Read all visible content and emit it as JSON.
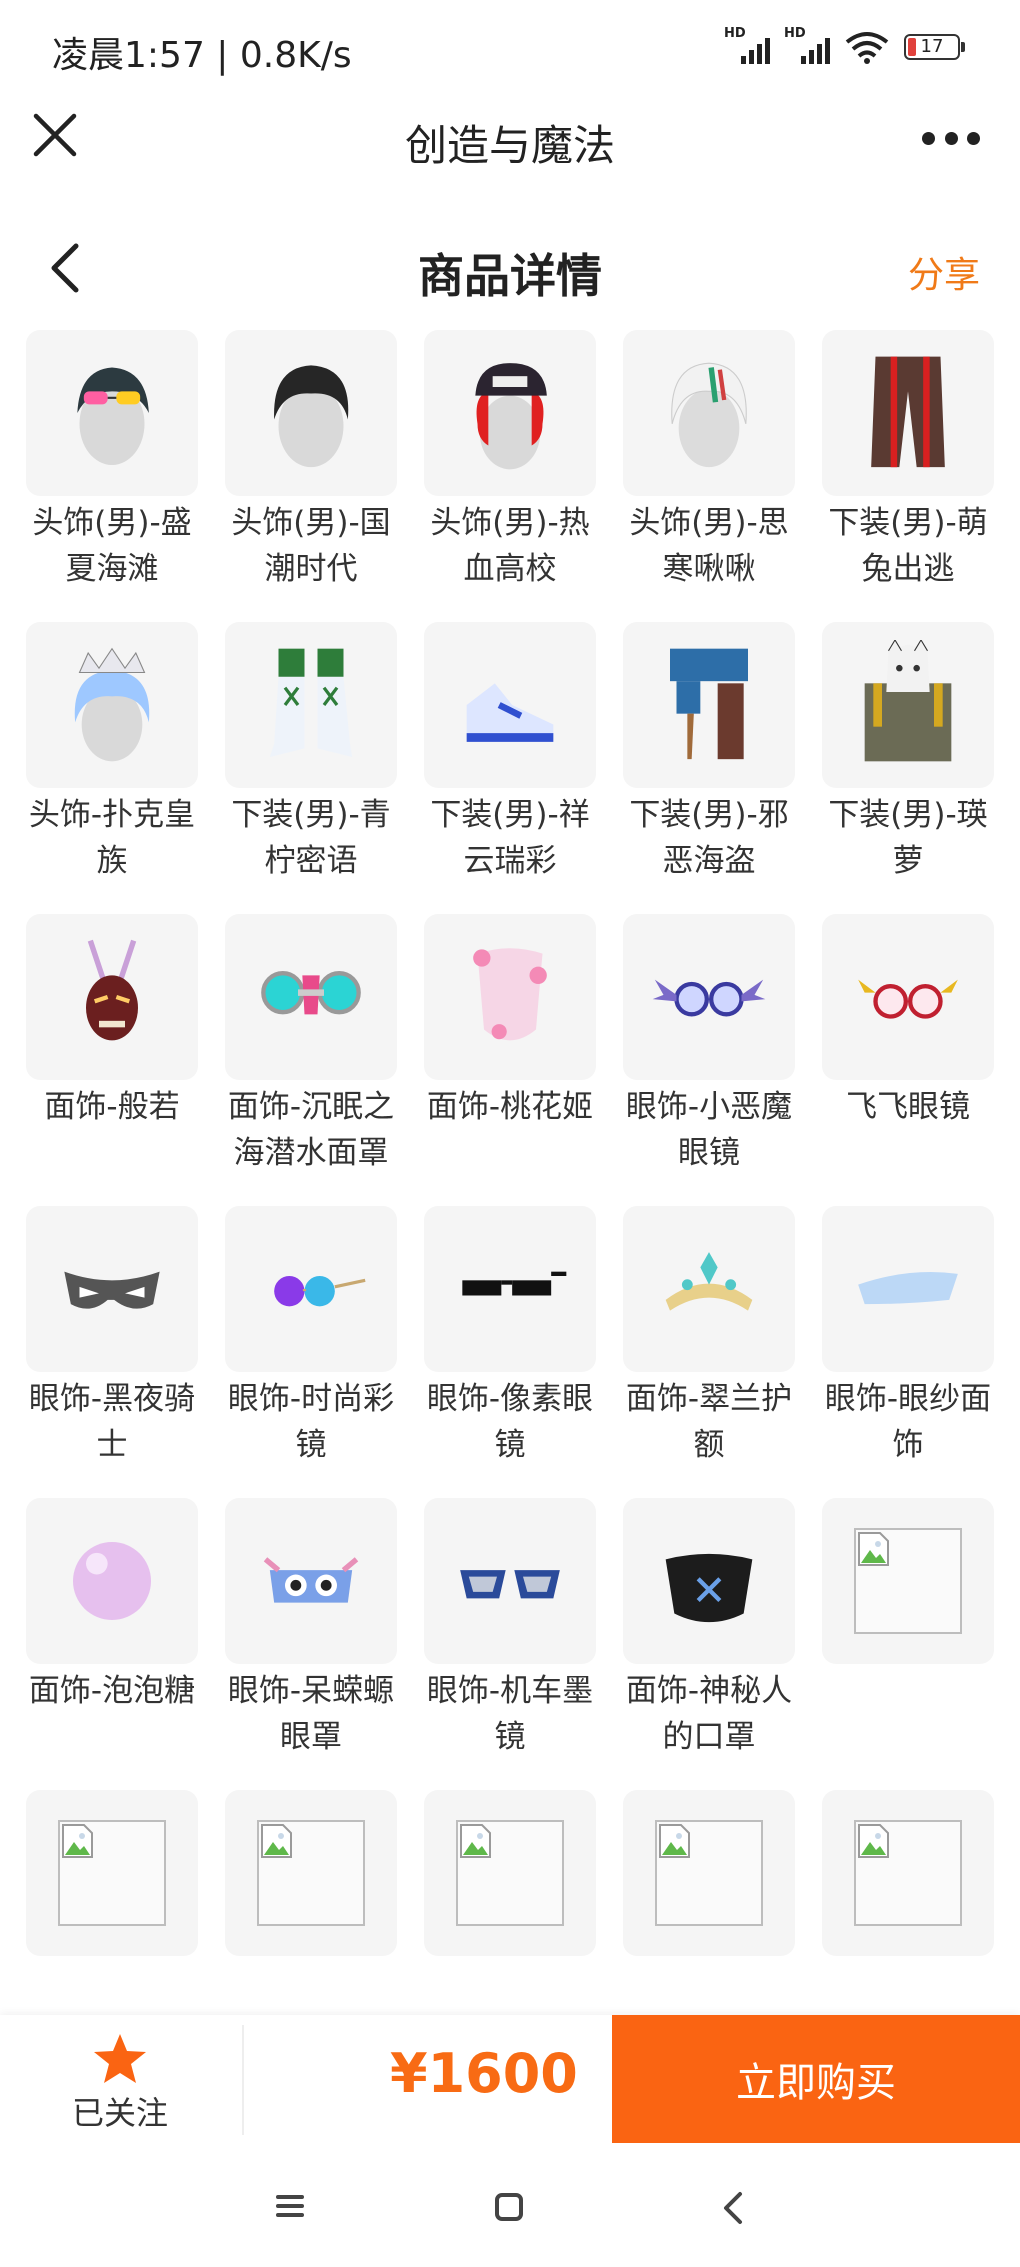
{
  "status": {
    "time": "凌晨1:57 | 0.8K/s",
    "battery": "17",
    "signal_label": "HD"
  },
  "app": {
    "title": "创造与魔法"
  },
  "page": {
    "title": "商品详情",
    "share": "分享"
  },
  "items": [
    {
      "name": "头饰(男)-盛夏海滩",
      "icon": "hair-sunglasses-icon"
    },
    {
      "name": "头饰(男)-国潮时代",
      "icon": "hair-dark-icon"
    },
    {
      "name": "头饰(男)-热血高校",
      "icon": "cap-red-hair-icon"
    },
    {
      "name": "头饰(男)-思寒啾啾",
      "icon": "hair-white-icon"
    },
    {
      "name": "下装(男)-萌兔出逃",
      "icon": "pants-icon"
    },
    {
      "name": "头饰-扑克皇族",
      "icon": "crown-hair-icon"
    },
    {
      "name": "下装(男)-青柠密语",
      "icon": "boots-green-icon"
    },
    {
      "name": "下装(男)-祥云瑞彩",
      "icon": "sneakers-icon"
    },
    {
      "name": "下装(男)-邪恶海盗",
      "icon": "pirate-legs-icon"
    },
    {
      "name": "下装(男)-瑛萝",
      "icon": "fox-mask-outfit-icon"
    },
    {
      "name": "面饰-般若",
      "icon": "hannya-mask-icon"
    },
    {
      "name": "面饰-沉眠之海潜水面罩",
      "icon": "diving-mask-icon"
    },
    {
      "name": "面饰-桃花姬",
      "icon": "blossom-veil-icon"
    },
    {
      "name": "眼饰-小恶魔眼镜",
      "icon": "bat-glasses-icon"
    },
    {
      "name": "飞飞眼镜",
      "icon": "winged-glasses-icon"
    },
    {
      "name": "眼饰-黑夜骑士",
      "icon": "night-mask-icon"
    },
    {
      "name": "眼饰-时尚彩镜",
      "icon": "color-glasses-icon"
    },
    {
      "name": "眼饰-像素眼镜",
      "icon": "pixel-glasses-icon"
    },
    {
      "name": "面饰-翠兰护额",
      "icon": "tiara-icon"
    },
    {
      "name": "眼饰-眼纱面饰",
      "icon": "eye-veil-icon"
    },
    {
      "name": "面饰-泡泡糖",
      "icon": "bubble-icon"
    },
    {
      "name": "眼饰-呆蝾螈眼罩",
      "icon": "axolotl-goggles-icon"
    },
    {
      "name": "眼饰-机车墨镜",
      "icon": "moto-sunglasses-icon"
    },
    {
      "name": "面饰-神秘人的口罩",
      "icon": "face-mask-icon"
    },
    {
      "name": "",
      "icon": "broken-image-icon"
    },
    {
      "name": "",
      "icon": "broken-image-icon"
    },
    {
      "name": "",
      "icon": "broken-image-icon"
    },
    {
      "name": "",
      "icon": "broken-image-icon"
    },
    {
      "name": "",
      "icon": "broken-image-icon"
    },
    {
      "name": "",
      "icon": "broken-image-icon"
    },
    {
      "name": "",
      "icon": "broken-image-icon"
    },
    {
      "name": "",
      "icon": "broken-image-icon"
    },
    {
      "name": "",
      "icon": "broken-image-icon"
    },
    {
      "name": "",
      "icon": "broken-image-icon"
    },
    {
      "name": "",
      "icon": "broken-image-icon"
    }
  ],
  "bottom": {
    "follow": "已关注",
    "price": "¥1600",
    "buy": "立即购买"
  },
  "colors": {
    "accent": "#fa6412",
    "price": "#f86b14",
    "share": "#f07a18",
    "star": "#fa6412"
  }
}
